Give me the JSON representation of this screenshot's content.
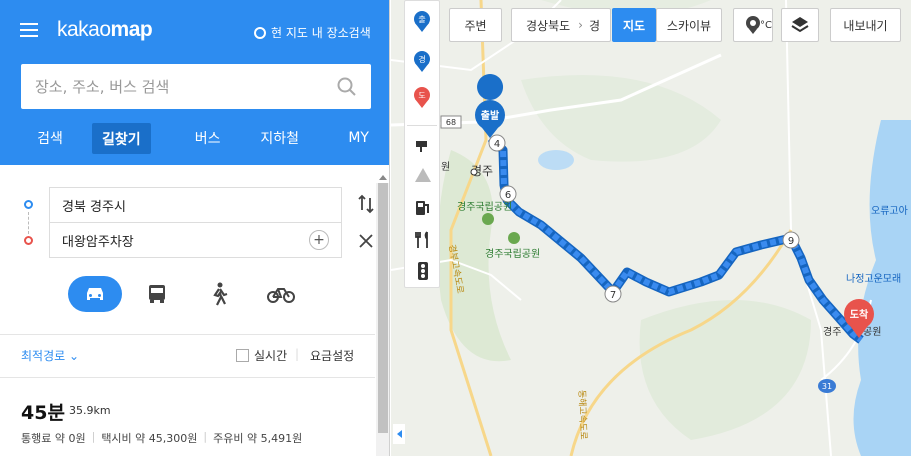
{
  "header": {
    "logo_light": "kakao",
    "logo_bold": "map",
    "nearby_label": "현 지도 내 장소검색"
  },
  "search": {
    "placeholder": "장소, 주소, 버스 검색"
  },
  "tabs": [
    {
      "label": "검색",
      "active": false
    },
    {
      "label": "길찾기",
      "active": true
    },
    {
      "label": "버스",
      "active": false
    },
    {
      "label": "지하철",
      "active": false
    },
    {
      "label": "MY",
      "active": false
    }
  ],
  "route": {
    "origin": "경북 경주시",
    "destination": "대왕암주차장"
  },
  "options": {
    "route_type": "최적경로",
    "realtime": "실시간",
    "fare_setting": "요금설정"
  },
  "result": {
    "time": "45분",
    "distance": "35.9km",
    "toll": "통행료 약 0원",
    "taxi": "택시비 약 45,300원",
    "fuel": "주유비 약 5,491원"
  },
  "map": {
    "region_breadcrumb": "경상북도",
    "breadcrumb_trailing": "경",
    "nearby_button": "주변",
    "map_button": "지도",
    "skyview_button": "스카이뷰",
    "weather_fragment": "°C",
    "export_button": "내보내기",
    "side_icons": [
      "출",
      "경",
      "도"
    ],
    "start_marker": "출발",
    "end_marker": "도착",
    "waypoints": [
      "4",
      "6",
      "7",
      "9"
    ],
    "place_labels": [
      "경주",
      "경주국립공원",
      "경주국립공원",
      "나정고운모래",
      "오류고아",
      "경주",
      "공원",
      "원"
    ],
    "road_numbers": [
      "68",
      "31"
    ],
    "road_labels": [
      "경부고속도로",
      "동해고속도로"
    ],
    "colors": {
      "route": "#3a8bef",
      "route_dark": "#1565c0",
      "water": "#a9d4f5",
      "brand": "#2d8cf0"
    }
  }
}
